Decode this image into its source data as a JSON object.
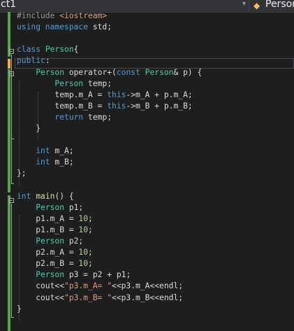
{
  "toolbar": {
    "file_dropdown": "ct1",
    "member_dropdown": "Persor",
    "dropdown_arrow": "▾"
  },
  "code_lines": [
    [
      [
        "pp",
        "#include "
      ],
      [
        "inc",
        "<iostream>"
      ]
    ],
    [
      [
        "k",
        "using namespace "
      ],
      [
        "p",
        "std;"
      ]
    ],
    [],
    [
      [
        "k",
        "class "
      ],
      [
        "t",
        "Person"
      ],
      [
        "p",
        "{"
      ]
    ],
    [
      [
        "k",
        "public"
      ],
      [
        "p",
        ":"
      ]
    ],
    [
      [
        "p",
        "    "
      ],
      [
        "t",
        "Person"
      ],
      [
        "p",
        " operator+("
      ],
      [
        "k",
        "const "
      ],
      [
        "t",
        "Person"
      ],
      [
        "p",
        "& p) {"
      ]
    ],
    [
      [
        "p",
        "        "
      ],
      [
        "t",
        "Person"
      ],
      [
        "p",
        " temp;"
      ]
    ],
    [
      [
        "p",
        "        temp.m_A = "
      ],
      [
        "k",
        "this"
      ],
      [
        "p",
        "->m_A + p.m_A;"
      ]
    ],
    [
      [
        "p",
        "        temp.m_B = "
      ],
      [
        "k",
        "this"
      ],
      [
        "p",
        "->m_B + p.m_B;"
      ]
    ],
    [
      [
        "p",
        "        "
      ],
      [
        "k",
        "return"
      ],
      [
        "p",
        " temp;"
      ]
    ],
    [
      [
        "p",
        "    }"
      ]
    ],
    [],
    [
      [
        "p",
        "    "
      ],
      [
        "k",
        "int"
      ],
      [
        "p",
        " m_A;"
      ]
    ],
    [
      [
        "p",
        "    "
      ],
      [
        "k",
        "int"
      ],
      [
        "p",
        " m_B;"
      ]
    ],
    [
      [
        "p",
        "};"
      ]
    ],
    [],
    [
      [
        "k",
        "int "
      ],
      [
        "f",
        "main"
      ],
      [
        "p",
        "() {"
      ]
    ],
    [
      [
        "p",
        "    "
      ],
      [
        "t",
        "Person"
      ],
      [
        "p",
        " p1;"
      ]
    ],
    [
      [
        "p",
        "    p1.m_A = "
      ],
      [
        "n",
        "10"
      ],
      [
        "p",
        ";"
      ]
    ],
    [
      [
        "p",
        "    p1.m_B = "
      ],
      [
        "n",
        "10"
      ],
      [
        "p",
        ";"
      ]
    ],
    [
      [
        "p",
        "    "
      ],
      [
        "t",
        "Person"
      ],
      [
        "p",
        " p2;"
      ]
    ],
    [
      [
        "p",
        "    p2.m_A = "
      ],
      [
        "n",
        "10"
      ],
      [
        "p",
        ";"
      ]
    ],
    [
      [
        "p",
        "    p2.m_B = "
      ],
      [
        "n",
        "10"
      ],
      [
        "p",
        ";"
      ]
    ],
    [
      [
        "p",
        "    "
      ],
      [
        "t",
        "Person"
      ],
      [
        "p",
        " p3 = p2 + p1;"
      ]
    ],
    [
      [
        "p",
        "    cout<<"
      ],
      [
        "s",
        "\"p3.m_A= \""
      ],
      [
        "p",
        "<<p3.m_A<<endl;"
      ]
    ],
    [
      [
        "p",
        "    cout<<"
      ],
      [
        "s",
        "\"p3.m_B= \""
      ],
      [
        "p",
        "<<p3.m_B<<endl;"
      ]
    ],
    [
      [
        "p",
        "}"
      ]
    ]
  ],
  "colors": {
    "keyword": "#569cd6",
    "type": "#4ec9b0",
    "string": "#d69d85",
    "number": "#b5cea8",
    "preprocessor": "#9b9b9b",
    "default": "#dcdcdc",
    "change_saved": "#57a64a",
    "change_unsaved": "#efb42c"
  }
}
